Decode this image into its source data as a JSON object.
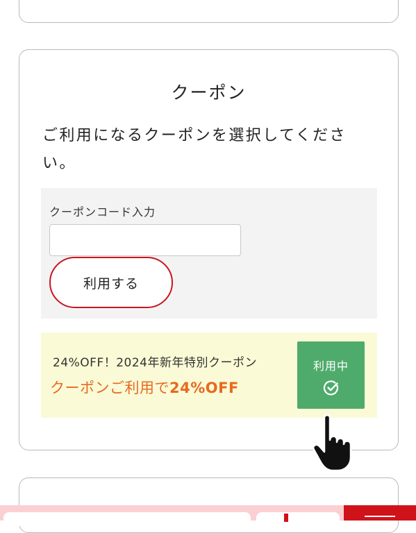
{
  "coupon_section": {
    "title": "クーポン",
    "description": "ご利用になるクーポンを選択してください。",
    "code_label": "クーポンコード入力",
    "code_value": "",
    "apply_button": "利用する"
  },
  "applied_coupon": {
    "name": "24%OFF！2024年新年特別クーポン",
    "discount_prefix": "クーポンご利用で",
    "discount_value": "24%OFF",
    "status_button": "利用中",
    "status_icon": "check-circle-icon"
  },
  "colors": {
    "accent_red": "#c8161d",
    "in_use_green": "#4fab6b",
    "discount_orange": "#e8691e",
    "coupon_bg": "#fafad6"
  }
}
